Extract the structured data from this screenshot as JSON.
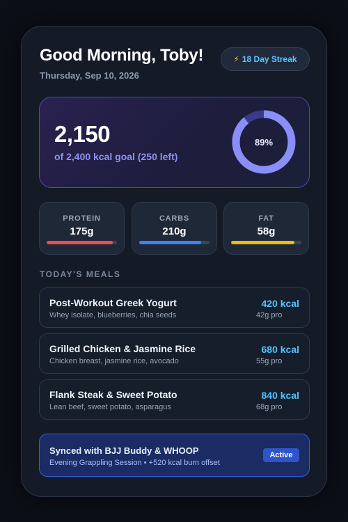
{
  "header": {
    "greeting": "Good Morning, Toby!",
    "date": "Thursday, Sep 10, 2026",
    "streak_label": "18 Day Streak",
    "streak_icon": "lightning-bolt-icon"
  },
  "calories": {
    "value": "2,150",
    "goal_text": "of 2,400 kcal goal (250 left)",
    "percent_label": "89%",
    "progress": 0.89,
    "colors": {
      "ring": "#8a8ef8",
      "ring_track": "#3a3a8a"
    }
  },
  "macros": [
    {
      "label": "PROTEIN",
      "value": "175g",
      "progress": 0.94,
      "color": "#ef4b55"
    },
    {
      "label": "CARBS",
      "value": "210g",
      "progress": 0.88,
      "color": "#3b82f6"
    },
    {
      "label": "FAT",
      "value": "58g",
      "progress": 0.9,
      "color": "#f2b90f"
    }
  ],
  "meals_section": {
    "title": "TODAY'S MEALS"
  },
  "meals": [
    {
      "name": "Post-Workout Greek Yogurt",
      "desc": "Whey isolate, blueberries, chia seeds",
      "kcal": "420 kcal",
      "protein": "42g pro"
    },
    {
      "name": "Grilled Chicken & Jasmine Rice",
      "desc": "Chicken breast, jasmine rice, avocado",
      "kcal": "680 kcal",
      "protein": "55g pro"
    },
    {
      "name": "Flank Steak & Sweet Potato",
      "desc": "Lean beef, sweet potato, asparagus",
      "kcal": "840 kcal",
      "protein": "68g pro"
    }
  ],
  "sync": {
    "title": "Synced with BJJ Buddy & WHOOP",
    "subtitle": "Evening Grappling Session • +520 kcal burn offset",
    "badge": "Active"
  },
  "colors": {
    "accent": "#55c2ff",
    "background": "#0b0f17",
    "card": "#141b27"
  }
}
